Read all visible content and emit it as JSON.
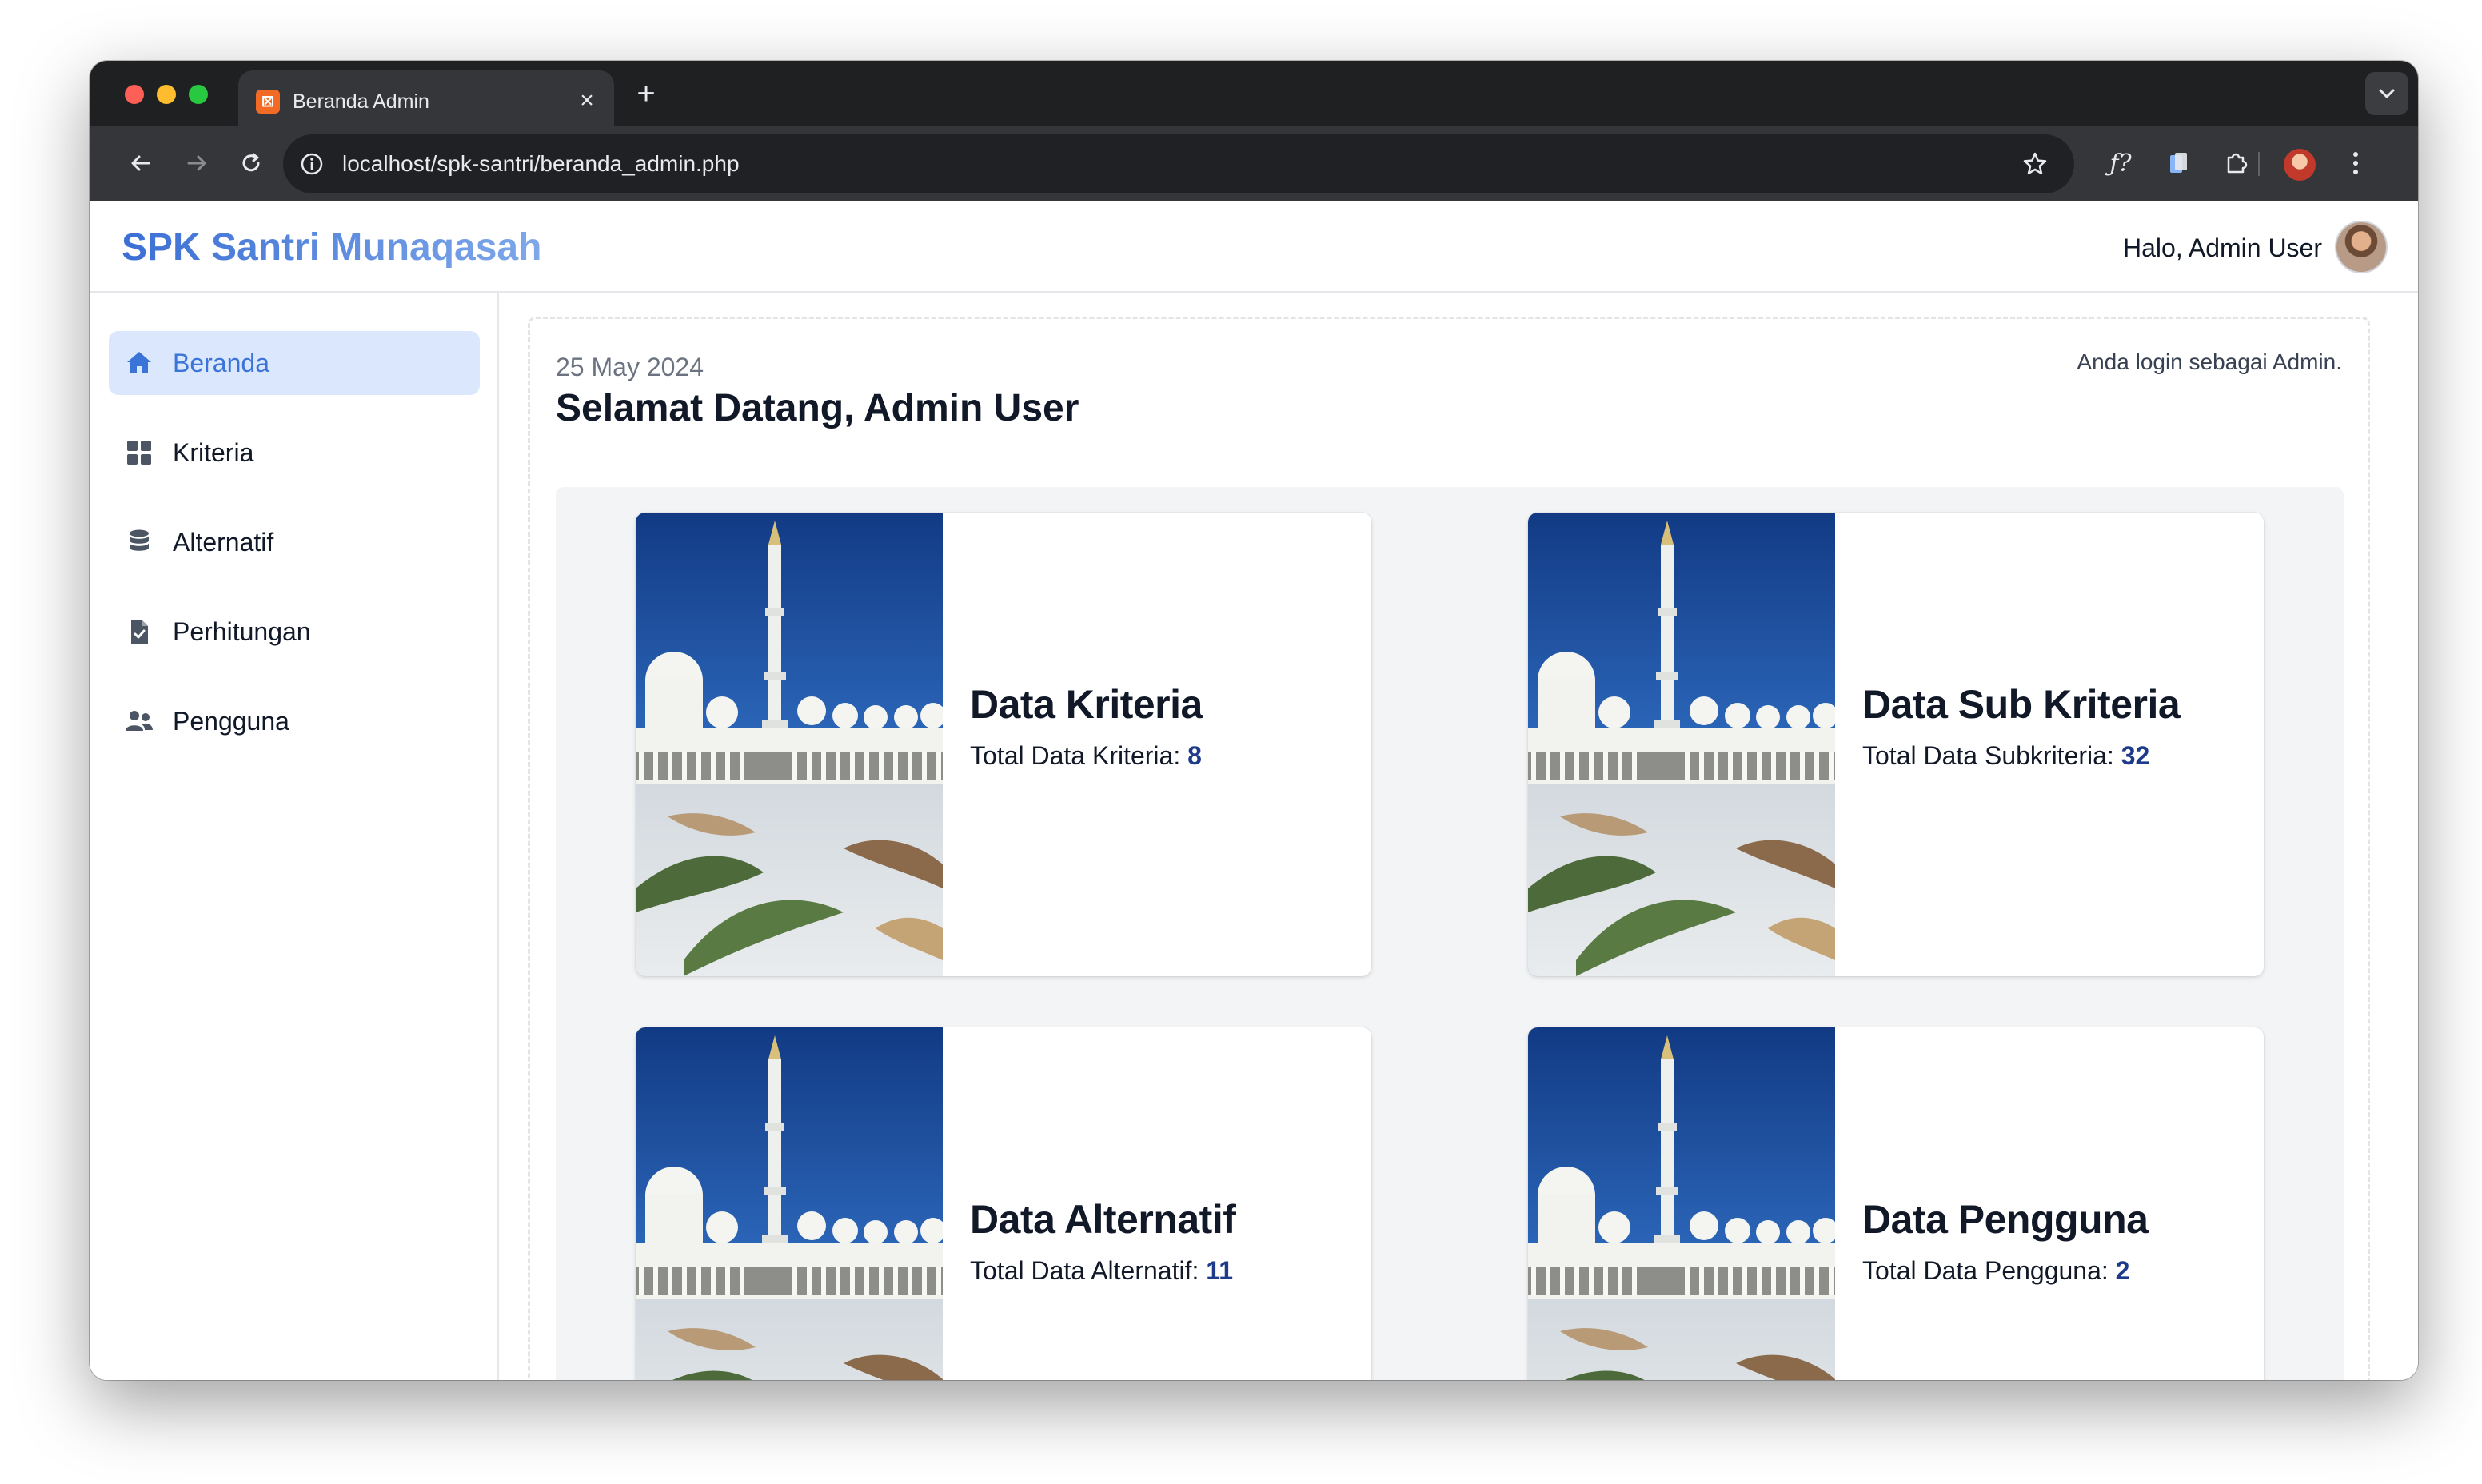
{
  "browser": {
    "tab_title": "Beranda Admin",
    "url": "localhost/spk-santri/beranda_admin.php"
  },
  "header": {
    "brand": "SPK Santri Munaqasah",
    "greeting": "Halo, Admin User"
  },
  "sidebar": {
    "items": [
      {
        "label": "Beranda",
        "icon": "home-icon",
        "active": true
      },
      {
        "label": "Kriteria",
        "icon": "grid-icon",
        "active": false
      },
      {
        "label": "Alternatif",
        "icon": "database-icon",
        "active": false
      },
      {
        "label": "Perhitungan",
        "icon": "file-check-icon",
        "active": false
      },
      {
        "label": "Pengguna",
        "icon": "users-icon",
        "active": false
      }
    ]
  },
  "main": {
    "date": "25 May 2024",
    "welcome": "Selamat Datang, Admin User",
    "login_note": "Anda login sebagai Admin.",
    "cards": [
      {
        "title": "Data Kriteria",
        "label": "Total Data Kriteria:",
        "value": "8"
      },
      {
        "title": "Data Sub Kriteria",
        "label": "Total Data Subkriteria:",
        "value": "32"
      },
      {
        "title": "Data Alternatif",
        "label": "Total Data Alternatif:",
        "value": "11"
      },
      {
        "title": "Data Pengguna",
        "label": "Total Data Pengguna:",
        "value": "2"
      }
    ]
  },
  "colors": {
    "accent": "#3b74d9",
    "active_bg": "#dbe7fd",
    "number": "#1e3a8a"
  }
}
